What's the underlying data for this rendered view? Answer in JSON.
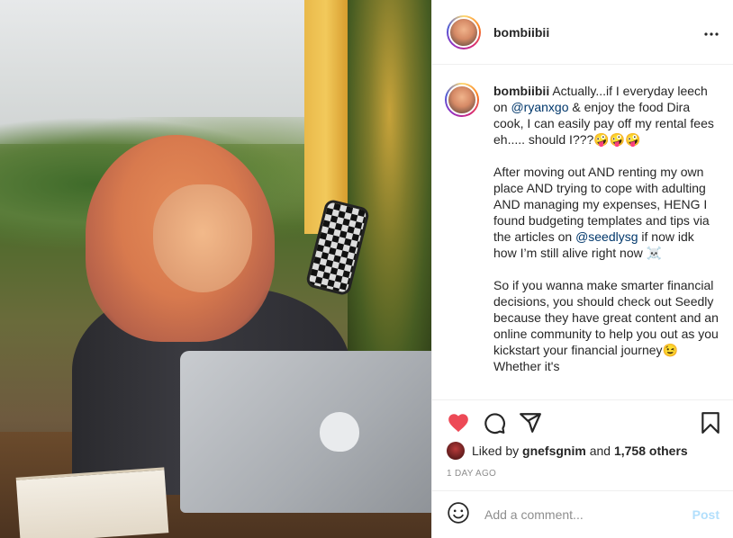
{
  "post": {
    "username": "bombiibii",
    "caption_user": "bombiibii",
    "caption": {
      "p1_a": " Actually...if I everyday leech on ",
      "mention1": "@ryanxgo",
      "p1_b": " & enjoy the food Dira cook, I can easily pay off my rental fees eh..... should I???🤪🤪🤪",
      "p2_a": "After moving out AND renting my own place AND trying to cope with adulting AND managing my expenses, HENG I found budgeting templates and tips via the articles on ",
      "mention2": "@seedlysg",
      "p2_b": " if now idk how I’m still alive right now ☠️",
      "p3": "So if you wanna make smarter financial decisions, you should check out Seedly because they have great content and an online community to help you out as you kickstart your financial journey😉Whether it's"
    },
    "likes": {
      "prefix": "Liked by ",
      "user": "gnefsgnim",
      "middle": " and ",
      "count": "1,758 others"
    },
    "timestamp": "1 DAY AGO"
  },
  "comment": {
    "placeholder": "Add a comment...",
    "post_label": "Post"
  },
  "icons": {
    "more": "more-options-icon",
    "like": "heart-icon",
    "comment": "comment-icon",
    "share": "share-icon",
    "save": "bookmark-icon",
    "emoji": "emoji-icon"
  },
  "colors": {
    "heart": "#ed4956",
    "mention": "#00376b",
    "post_disabled": "#b2dffc",
    "muted": "#8e8e8e"
  }
}
